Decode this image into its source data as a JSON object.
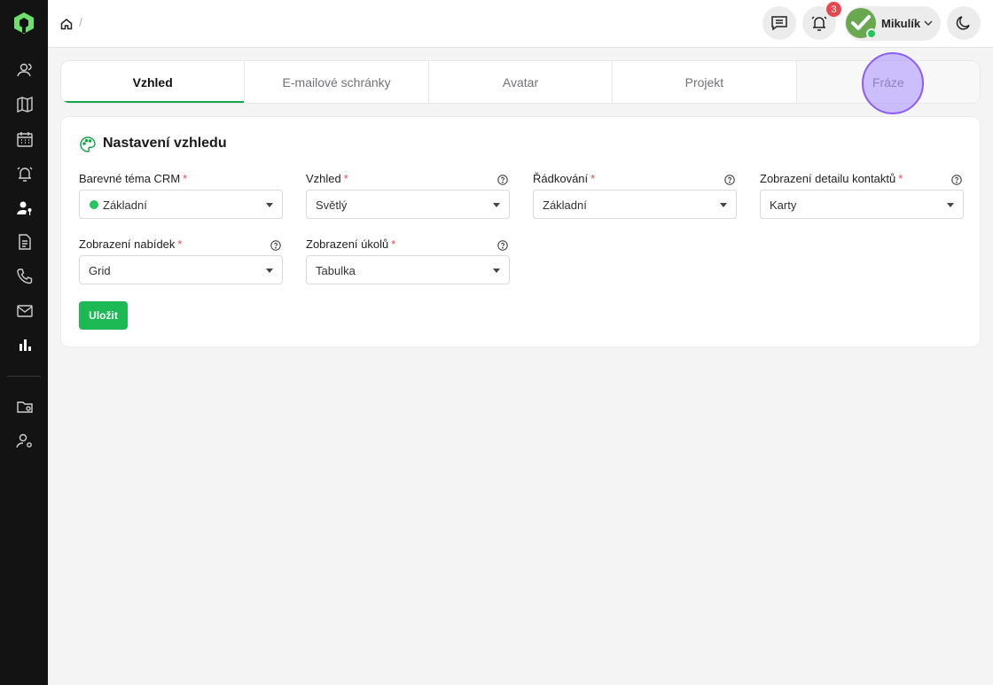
{
  "colors": {
    "accent": "#16a34a",
    "sidebar": "#131313",
    "danger": "#e5484d",
    "save": "#1db954"
  },
  "sidebar": {
    "logo": "app-logo",
    "items": [
      {
        "name": "contacts-icon"
      },
      {
        "name": "map-icon"
      },
      {
        "name": "calendar-icon"
      },
      {
        "name": "alarm-icon"
      },
      {
        "name": "user-key-icon"
      },
      {
        "name": "document-icon"
      },
      {
        "name": "phone-icon"
      },
      {
        "name": "mail-icon"
      },
      {
        "name": "bar-chart-icon"
      },
      {
        "name": "folder-settings-icon"
      },
      {
        "name": "user-settings-icon"
      }
    ]
  },
  "header": {
    "breadcrumb_separator": "/",
    "notifications_count": "3",
    "user_name": "Mikulík"
  },
  "tabs": [
    {
      "label": "Vzhled",
      "active": true
    },
    {
      "label": "E-mailové schránky"
    },
    {
      "label": "Avatar"
    },
    {
      "label": "Projekt"
    },
    {
      "label": "Fráze"
    }
  ],
  "appearance": {
    "title": "Nastavení vzhledu",
    "required_mark": "*",
    "fields": [
      {
        "label": "Barevné téma CRM",
        "value": "Základní"
      },
      {
        "label": "Vzhled",
        "value": "Světlý"
      },
      {
        "label": "Řádkování",
        "value": "Základní"
      },
      {
        "label": "Zobrazení detailu kontaktů",
        "value": "Karty"
      },
      {
        "label": "Zobrazení nabídek",
        "value": "Grid"
      },
      {
        "label": "Zobrazení úkolů",
        "value": "Tabulka"
      }
    ],
    "save_label": "Uložit"
  }
}
